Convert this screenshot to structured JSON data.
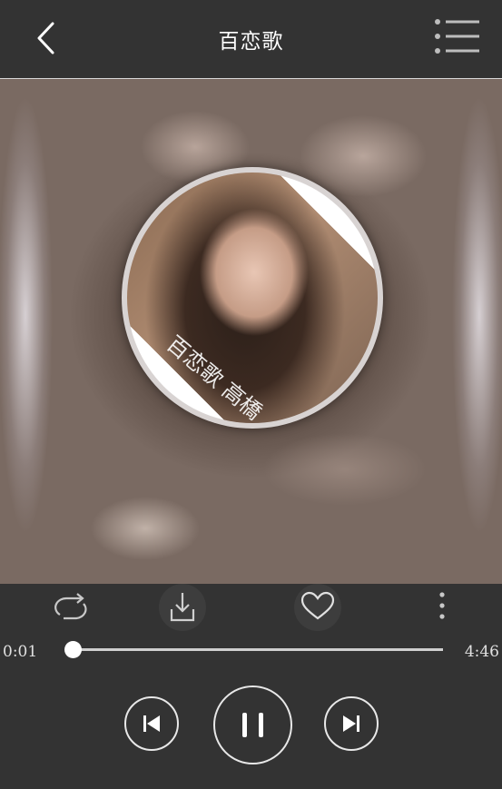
{
  "header": {
    "title": "百恋歌",
    "back_icon": "chevron-left-icon",
    "menu_icon": "playlist-menu-icon"
  },
  "album": {
    "cover_text": "百恋歌 高橋"
  },
  "actions": [
    {
      "name": "repeat",
      "icon": "repeat-icon"
    },
    {
      "name": "download",
      "icon": "download-icon"
    },
    {
      "name": "like",
      "icon": "heart-icon"
    },
    {
      "name": "more",
      "icon": "more-vertical-icon"
    }
  ],
  "player": {
    "current_time": "0:01",
    "total_time": "4:46",
    "progress": 0.004,
    "controls": [
      "previous",
      "pause",
      "next"
    ]
  },
  "colors": {
    "background": "#333333",
    "foreground": "#ffffff"
  }
}
